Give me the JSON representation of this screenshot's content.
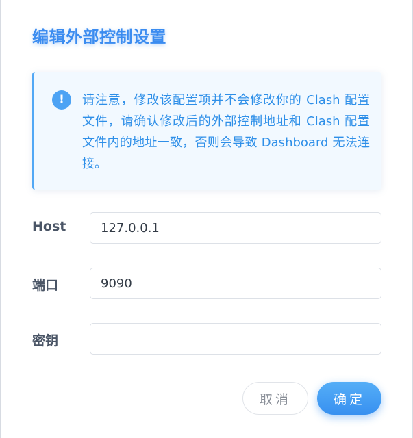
{
  "dialog": {
    "title": "编辑外部控制设置"
  },
  "alert": {
    "icon": "info-icon",
    "text": "请注意，修改该配置项并不会修改你的 Clash 配置文件，请确认修改后的外部控制地址和 Clash 配置文件内的地址一致，否则会导致 Dashboard 无法连接。"
  },
  "form": {
    "host": {
      "label": "Host",
      "value": "127.0.0.1"
    },
    "port": {
      "label": "端口",
      "value": "9090"
    },
    "secret": {
      "label": "密钥",
      "value": ""
    }
  },
  "actions": {
    "cancel_label": "取消",
    "ok_label": "确定"
  },
  "colors": {
    "accent": "#3b8cf0",
    "alert_bg": "#f2f9ff",
    "alert_text": "#2e8fe8"
  }
}
